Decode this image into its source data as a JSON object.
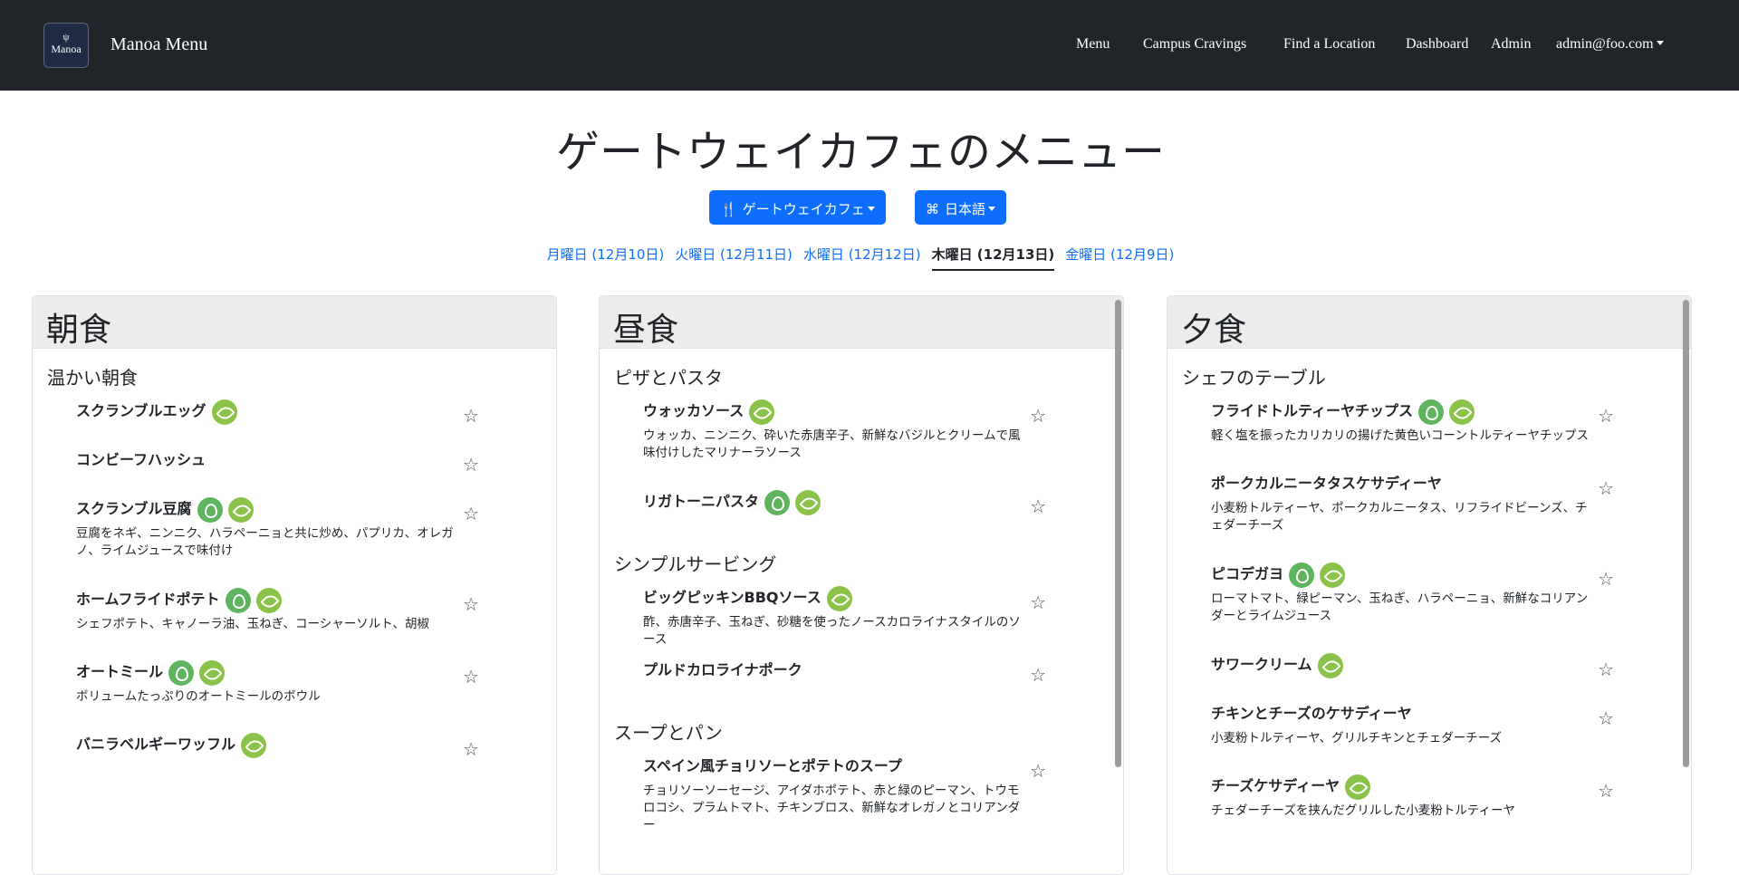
{
  "nav": {
    "logo_text": "Manoa",
    "brand": "Manoa Menu",
    "links": [
      "Menu",
      "Campus Cravings",
      "Find a Location",
      "Dashboard",
      "Admin"
    ],
    "user": "admin@foo.com"
  },
  "page_title": "ゲートウェイカフェのメニュー",
  "location_button": "ゲートウェイカフェ",
  "language_button": "日本語",
  "days": [
    "月曜日 (12月10日)",
    "火曜日 (12月11日)",
    "水曜日 (12月12日)",
    "木曜日 (12月13日)",
    "金曜日 (12月9日)"
  ],
  "active_day": "木曜日 (12月13日)",
  "columns": [
    {
      "title": "朝食",
      "sections": [
        {
          "name": "温かい朝食",
          "items": [
            {
              "name": "スクランブルエッグ",
              "badges": [
                "vegetarian"
              ],
              "desc": ""
            },
            {
              "name": "コンビーフハッシュ",
              "badges": [],
              "desc": ""
            },
            {
              "name": "スクランブル豆腐",
              "badges": [
                "vegan",
                "vegetarian"
              ],
              "desc": "豆腐をネギ、ニンニク、ハラペーニョと共に炒め、パプリカ、オレガノ、ライムジュースで味付け"
            },
            {
              "name": "ホームフライドポテト",
              "badges": [
                "vegan",
                "vegetarian"
              ],
              "desc": "シェフポテト、キャノーラ油、玉ねぎ、コーシャーソルト、胡椒"
            },
            {
              "name": "オートミール",
              "badges": [
                "vegan",
                "vegetarian"
              ],
              "desc": "ボリュームたっぷりのオートミールのボウル"
            },
            {
              "name": "バニラベルギーワッフル",
              "badges": [
                "vegetarian"
              ],
              "desc": ""
            }
          ]
        }
      ]
    },
    {
      "title": "昼食",
      "sections": [
        {
          "name": "ピザとパスタ",
          "items": [
            {
              "name": "ウォッカソース",
              "badges": [
                "vegetarian"
              ],
              "desc": "ウォッカ、ニンニク、砕いた赤唐辛子、新鮮なバジルとクリームで風味付けしたマリナーラソース"
            },
            {
              "name": "リガトーニパスタ",
              "badges": [
                "vegan",
                "vegetarian"
              ],
              "desc": ""
            }
          ]
        },
        {
          "name": "シンプルサービング",
          "items": [
            {
              "name": "ビッグピッキンBBQソース",
              "badges": [
                "vegetarian"
              ],
              "desc": "酢、赤唐辛子、玉ねぎ、砂糖を使ったノースカロライナスタイルのソース"
            },
            {
              "name": "プルドカロライナポーク",
              "badges": [],
              "desc": ""
            }
          ]
        },
        {
          "name": "スープとパン",
          "items": [
            {
              "name": "スペイン風チョリソーとポテトのスープ",
              "badges": [],
              "desc": "チョリソーソーセージ、アイダホポテト、赤と緑のピーマン、トウモロコシ、プラムトマト、チキンブロス、新鮮なオレガノとコリアンダー"
            }
          ]
        }
      ]
    },
    {
      "title": "夕食",
      "sections": [
        {
          "name": "シェフのテーブル",
          "items": [
            {
              "name": "フライドトルティーヤチップス",
              "badges": [
                "vegan",
                "vegetarian"
              ],
              "desc": "軽く塩を振ったカリカリの揚げた黄色いコーントルティーヤチップス"
            },
            {
              "name": "ポークカルニータタスケサディーヤ",
              "badges": [],
              "desc": "小麦粉トルティーヤ、ポークカルニータス、リフライドビーンズ、チェダーチーズ"
            },
            {
              "name": "ピコデガヨ",
              "badges": [
                "vegan",
                "vegetarian"
              ],
              "desc": "ローマトマト、緑ピーマン、玉ねぎ、ハラペーニョ、新鮮なコリアンダーとライムジュース"
            },
            {
              "name": "サワークリーム",
              "badges": [
                "vegetarian"
              ],
              "desc": ""
            },
            {
              "name": "チキンとチーズのケサディーヤ",
              "badges": [],
              "desc": "小麦粉トルティーヤ、グリルチキンとチェダーチーズ"
            },
            {
              "name": "チーズケサディーヤ",
              "badges": [
                "vegetarian"
              ],
              "desc": "チェダーチーズを挟んだグリルした小麦粉トルティーヤ"
            }
          ]
        }
      ]
    }
  ]
}
